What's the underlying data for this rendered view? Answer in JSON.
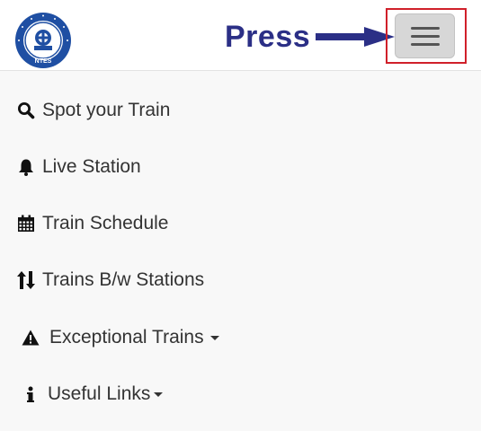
{
  "header": {
    "logo_icon": "indian-railways-ntes-logo",
    "logo_text": "NTES",
    "annotation_label": "Press",
    "annotation_color": "#2b2f86",
    "highlight_color": "#d0202a",
    "menu_icon": "hamburger-icon"
  },
  "nav": {
    "items": [
      {
        "label": "Spot your Train",
        "icon": "search-icon"
      },
      {
        "label": "Live Station",
        "icon": "bell-icon"
      },
      {
        "label": "Train Schedule",
        "icon": "calendar-icon"
      },
      {
        "label": "Trains B/w Stations",
        "icon": "sort-arrows-icon"
      },
      {
        "label": "Exceptional Trains",
        "icon": "warning-icon",
        "dropdown": true
      },
      {
        "label": "Useful Links",
        "icon": "info-icon",
        "dropdown": true
      }
    ]
  }
}
